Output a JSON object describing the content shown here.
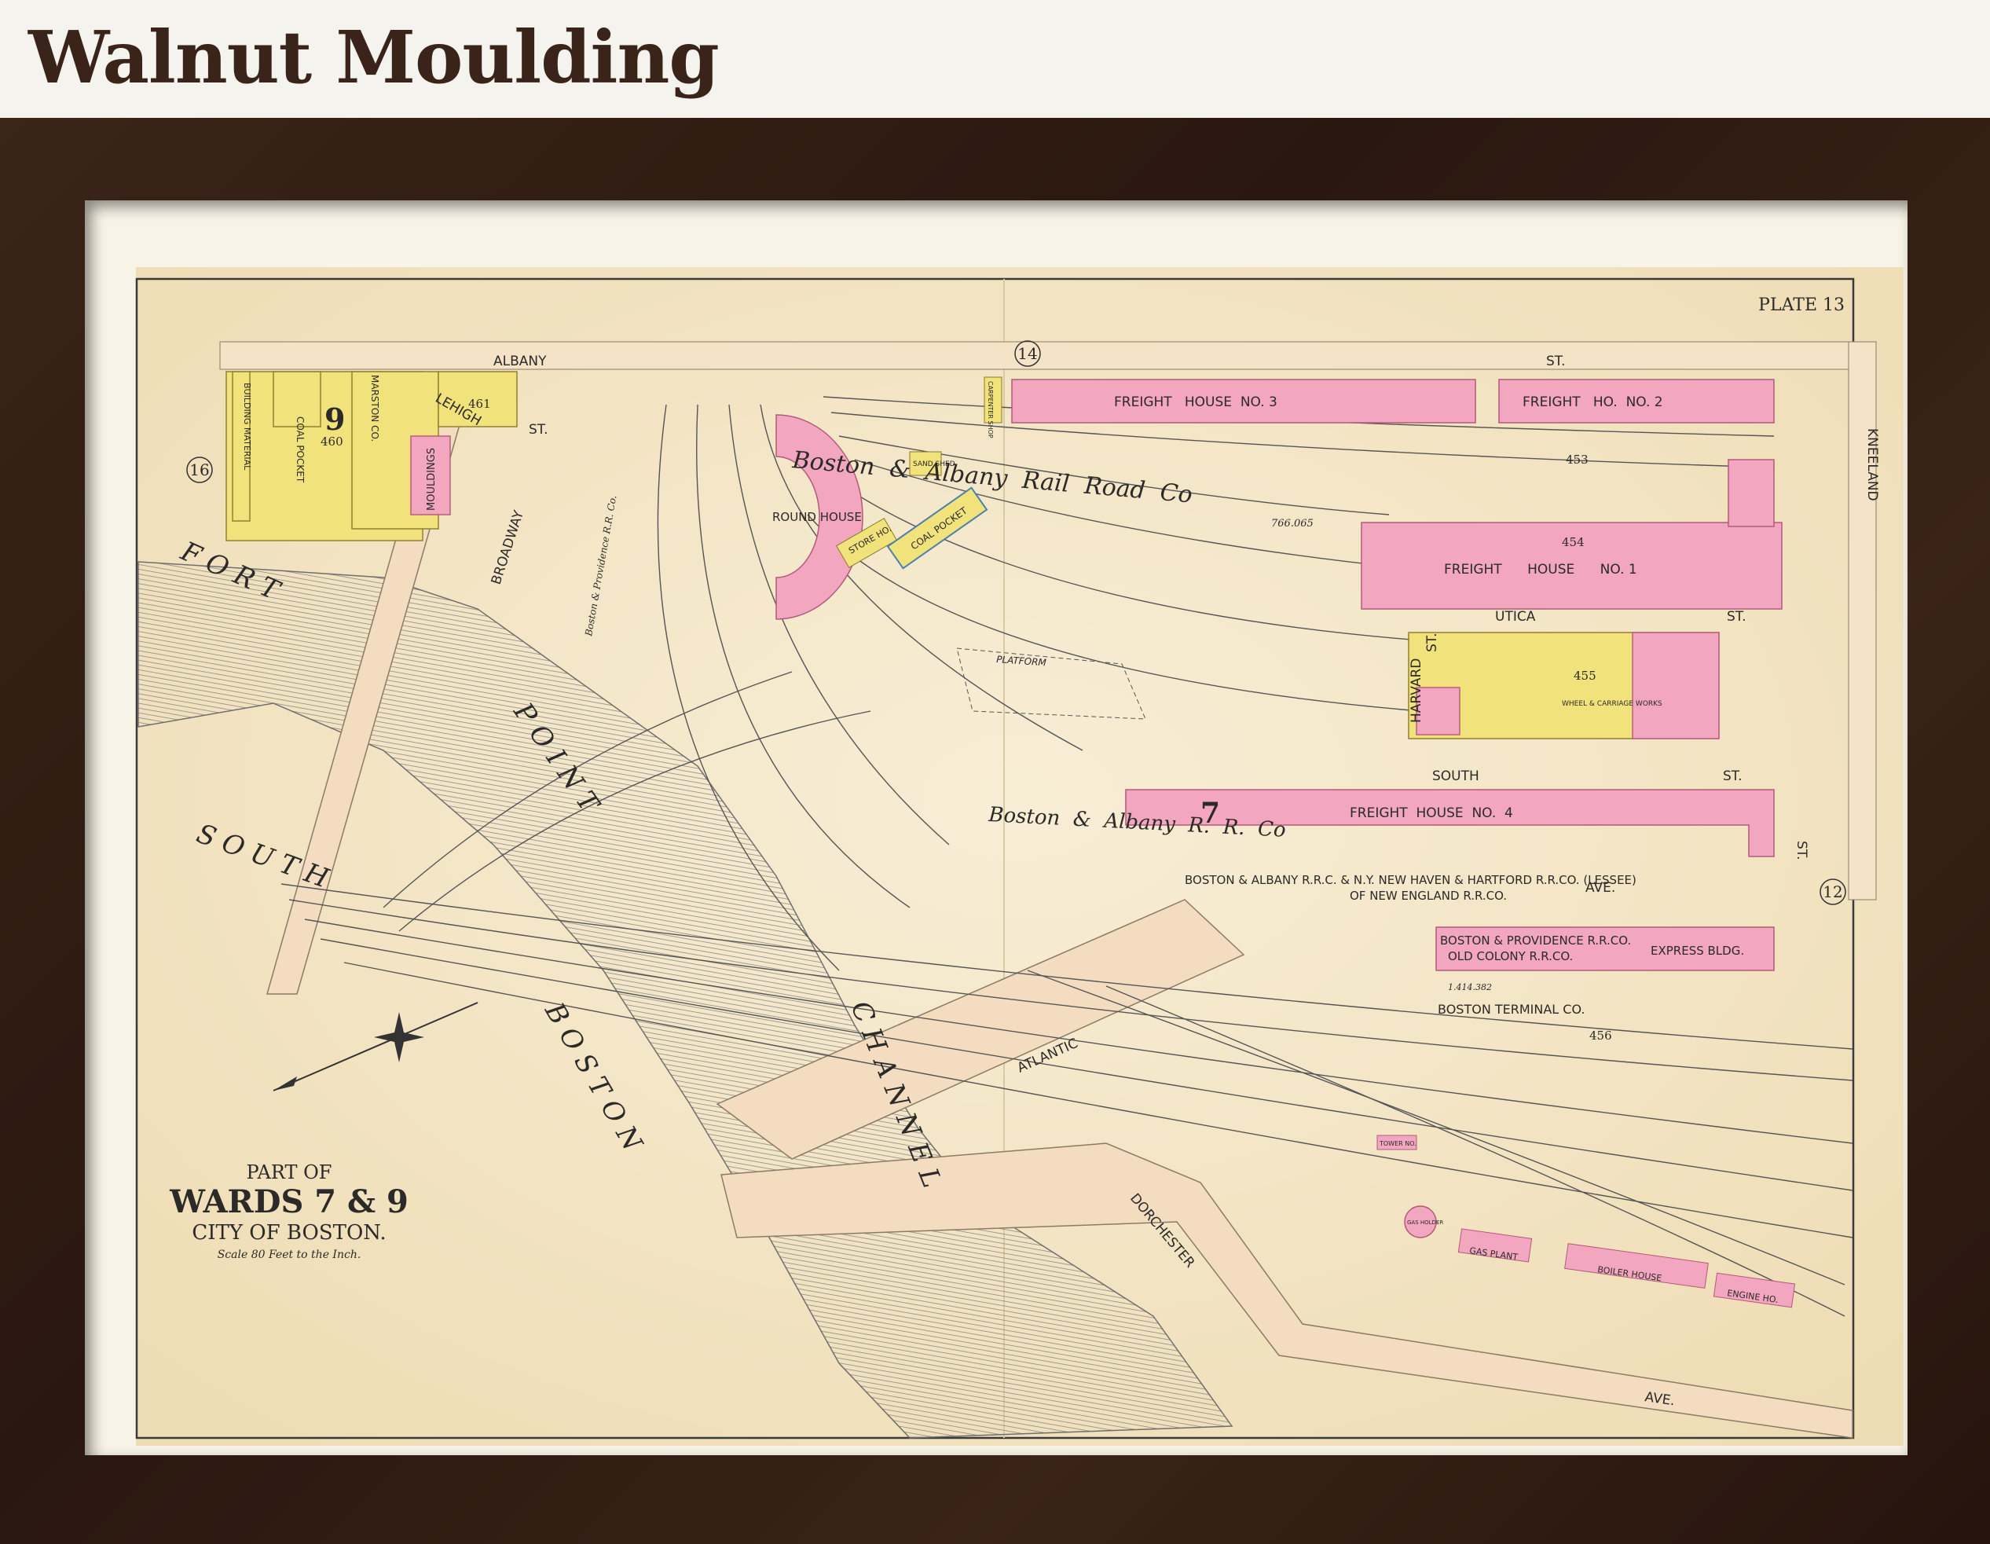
{
  "page_heading": "Walnut Moulding",
  "map": {
    "plate": "PLATE 13",
    "sheet_numbers": {
      "top": "14",
      "left": "16",
      "right": "12"
    },
    "streets": {
      "albany": "ALBANY",
      "st_top": "ST.",
      "kneeland": "KNEELAND",
      "lehigh": "LEHIGH",
      "lehigh_st": "ST.",
      "broadway": "BROADWAY",
      "utica": "UTICA",
      "utica_st": "ST.",
      "harvard": "HARVARD",
      "harvard_st": "ST.",
      "south": "SOUTH",
      "south_st": "ST.",
      "ave_right": "AVE.",
      "st_right": "ST.",
      "atlantic": "ATLANTIC",
      "dorchester": "DORCHESTER",
      "ave_bottom": "AVE."
    },
    "water": {
      "fort": "F O R T",
      "point": "P O I N T",
      "channel": "C H A N N E L",
      "south": "S O U T H",
      "boston": "B O S T O N"
    },
    "buildings": {
      "freight_3": "FREIGHT   HOUSE  NO. 3",
      "freight_2": "FREIGHT   HO.  NO. 2",
      "freight_1": "FREIGHT      HOUSE      NO. 1",
      "freight_4": "FREIGHT  HOUSE  NO.  4",
      "round_house": "ROUND HOUSE",
      "coal_pocket": "COAL POCKET",
      "coal_pocket_left": "COAL POCKET",
      "store_ho": "STORE HO.",
      "sand_shed": "SAND SHED",
      "platform": "PLATFORM",
      "mouldings": "MOULDINGS",
      "building_material": "BUILDING MATERIAL",
      "marston_co": "MARSTON CO.",
      "express_bldg": "EXPRESS BLDG.",
      "gas_plant": "GAS PLANT",
      "boiler_house": "BOILER HOUSE",
      "engine_ho": "ENGINE HO.",
      "gas_holder": "GAS HOLDER",
      "tower": "TOWER NO.",
      "carpenter": "CARPENTER SHOP",
      "wheel_works": "WHEEL & CARRIAGE WORKS"
    },
    "rail_labels": {
      "boston_albany_script": "Boston  &  Albany  Rail  Road  Co",
      "boston_albany_rr": "Boston  &  Albany  R.  R.  Co",
      "boston_providence": "Boston & Providence R.R. Co.",
      "lessee_line1": "BOSTON & ALBANY R.R.C. & N.Y. NEW HAVEN & HARTFORD R.R.CO. (LESSEE)",
      "lessee_line2": "OF NEW ENGLAND R.R.CO.",
      "bp_rr": "BOSTON & PROVIDENCE R.R.CO.",
      "old_colony": "OLD COLONY R.R.CO.",
      "terminal": "BOSTON TERMINAL CO."
    },
    "lot_numbers": {
      "n453": "453",
      "n454": "454",
      "n455": "455",
      "n456": "456",
      "n460": "460",
      "n461": "461",
      "n9": "9",
      "n7": "7",
      "area_upper": "766.065",
      "area_lower": "1.414.382"
    },
    "title_block": {
      "part_of": "PART OF",
      "wards": "WARDS 7 & 9",
      "city": "CITY OF BOSTON.",
      "scale": "Scale 80 Feet to the Inch."
    }
  },
  "colors": {
    "frame": "#2f1b12",
    "paper": "#f6ecd2",
    "pink": "#f2a6bf",
    "yellow": "#f1e27c",
    "road": "#f3dcc0",
    "water_hatch": "#8d8d8d"
  }
}
